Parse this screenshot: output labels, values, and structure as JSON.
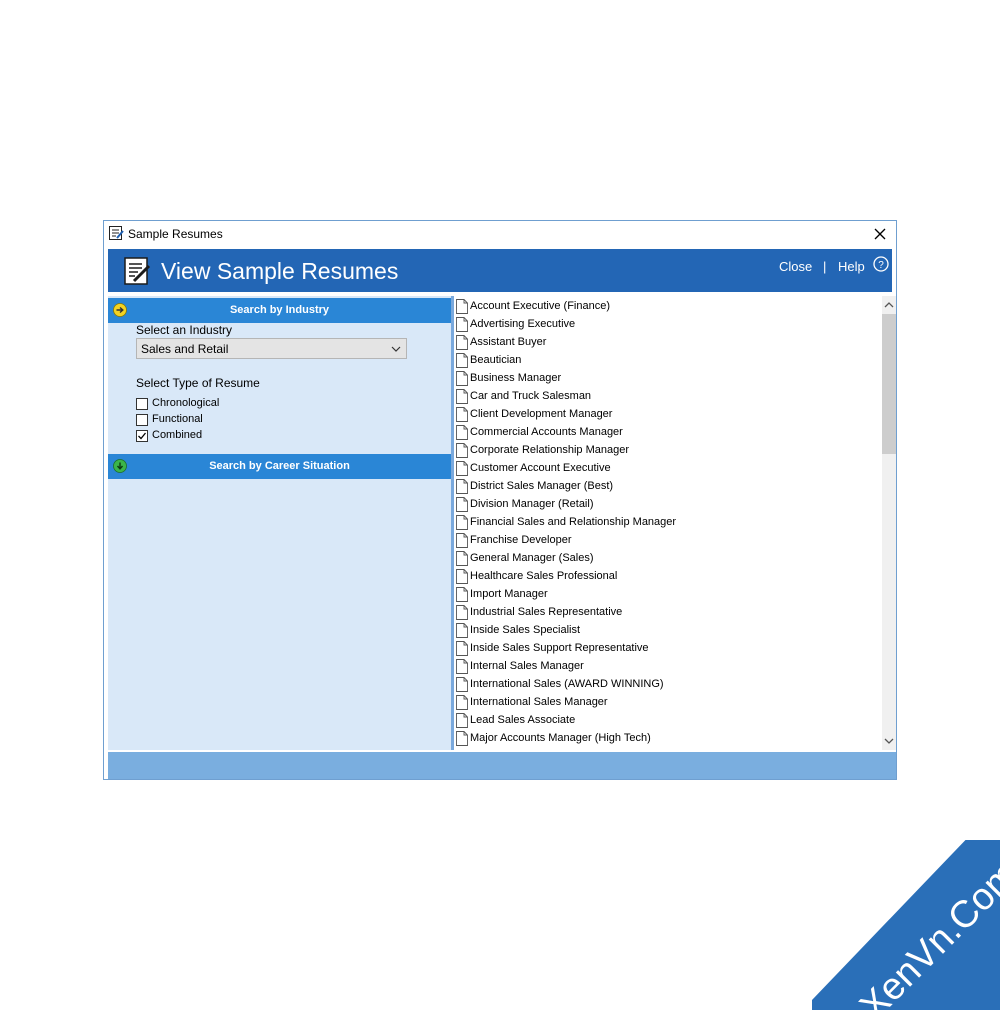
{
  "window": {
    "title": "Sample Resumes"
  },
  "banner": {
    "heading": "View Sample Resumes",
    "close_label": "Close",
    "separator": "|",
    "help_label": "Help"
  },
  "left": {
    "industry_section": "Search by Industry",
    "industry_label": "Select an Industry",
    "industry_value": "Sales and Retail",
    "type_label": "Select Type of Resume",
    "types": [
      {
        "label": "Chronological",
        "checked": false
      },
      {
        "label": "Functional",
        "checked": false
      },
      {
        "label": "Combined",
        "checked": true
      }
    ],
    "career_section": "Search by Career Situation"
  },
  "resumes": [
    "Account Executive (Finance)",
    "Advertising Executive",
    "Assistant Buyer",
    "Beautician",
    "Business Manager",
    "Car and Truck Salesman",
    "Client Development Manager",
    "Commercial Accounts Manager",
    "Corporate Relationship Manager",
    "Customer Account Executive",
    "District Sales Manager (Best)",
    "Division Manager (Retail)",
    "Financial Sales and Relationship Manager",
    "Franchise Developer",
    "General Manager (Sales)",
    "Healthcare Sales Professional",
    "Import Manager",
    "Industrial Sales Representative",
    "Inside Sales Specialist",
    "Inside Sales Support Representative",
    "Internal Sales Manager",
    "International Sales (AWARD WINNING)",
    "International Sales Manager",
    "Lead Sales Associate",
    "Major Accounts Manager (High Tech)"
  ],
  "watermark": {
    "text": "XenVn.Com"
  },
  "colors": {
    "banner": "#2366b5",
    "section_header": "#2a86d6",
    "left_pane": "#d9e8f8",
    "footer": "#7aaedf",
    "watermark_band": "#2a6fb8"
  }
}
